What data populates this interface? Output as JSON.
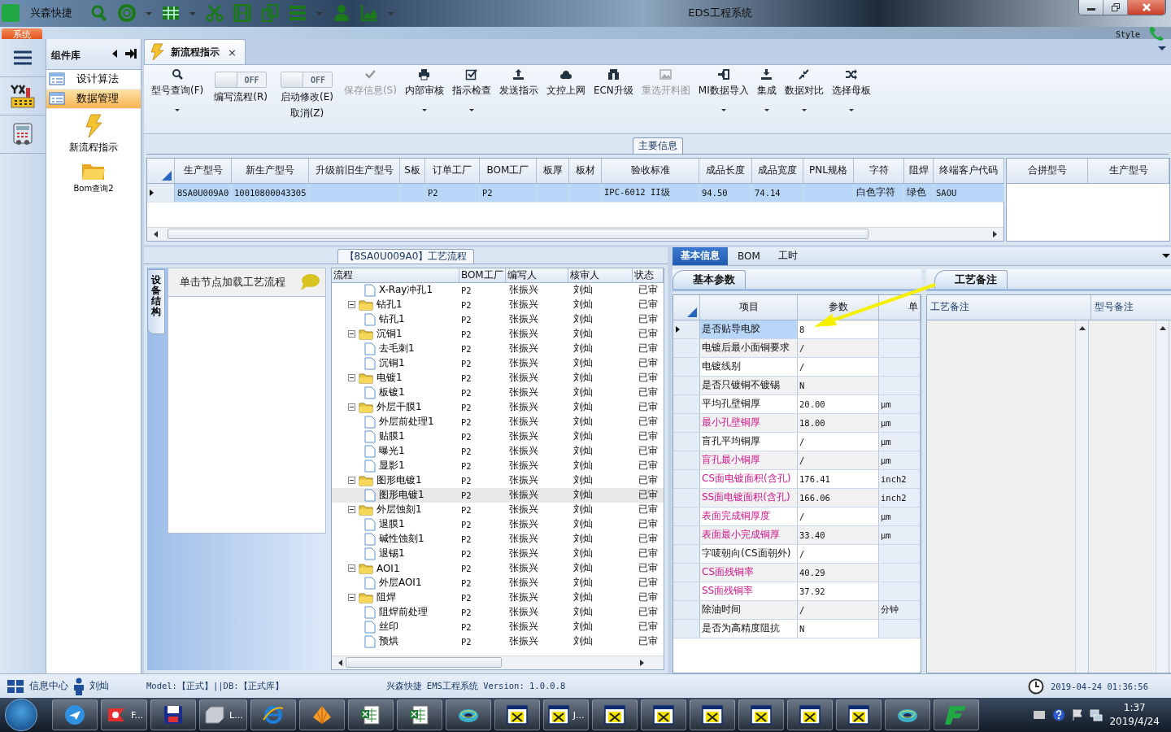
{
  "window": {
    "app_name": "兴森快捷",
    "title": "EDS工程系统",
    "menu_tab": "系统",
    "style_label": "Style"
  },
  "component_library": {
    "title": "组件库",
    "items": [
      {
        "label": "设计算法",
        "selected": false
      },
      {
        "label": "数据管理",
        "selected": true
      }
    ],
    "tools": [
      {
        "kind": "lightning",
        "label": "新流程指示"
      },
      {
        "kind": "folder",
        "label": "Bom查询2"
      }
    ]
  },
  "doc_tab": {
    "title": "新流程指示",
    "close": "×"
  },
  "ribbon": {
    "buttons": [
      {
        "kind": "button",
        "label": "型号查询(F)",
        "disabled": false,
        "dropdown": true
      },
      {
        "kind": "toggle",
        "label": "编写流程(R)",
        "toggle": "OFF",
        "on": false
      },
      {
        "kind": "toggle",
        "label": "启动修改(E)",
        "sublabel": "取消(Z)",
        "toggle": "OFF",
        "on": false
      },
      {
        "kind": "button",
        "label": "保存信息(S)",
        "disabled": true,
        "dropdown": false
      },
      {
        "kind": "button",
        "label": "内部审核",
        "disabled": false,
        "dropdown": true
      },
      {
        "kind": "button",
        "label": "指示检查",
        "disabled": false,
        "dropdown": true
      },
      {
        "kind": "button",
        "label": "发送指示",
        "disabled": false,
        "dropdown": false
      },
      {
        "kind": "button",
        "label": "文控上网",
        "disabled": false,
        "dropdown": false
      },
      {
        "kind": "button",
        "label": "ECN升级",
        "disabled": false,
        "dropdown": false
      },
      {
        "kind": "button",
        "label": "重选开料图",
        "disabled": true,
        "dropdown": false
      },
      {
        "kind": "button",
        "label": "MI数据导入",
        "disabled": false,
        "dropdown": true
      },
      {
        "kind": "button",
        "label": "集成",
        "disabled": false,
        "dropdown": true
      },
      {
        "kind": "button",
        "label": "数据对比",
        "disabled": false,
        "dropdown": true
      },
      {
        "kind": "button",
        "label": "选择母板",
        "disabled": false,
        "dropdown": true
      }
    ]
  },
  "main_info": {
    "title": "主要信息",
    "columns": [
      "生产型号",
      "新生产型号",
      "升级前旧生产型号",
      "S板",
      "订单工厂",
      "BOM工厂",
      "板厚",
      "板材",
      "验收标准",
      "成品长度",
      "成品宽度",
      "PNL规格",
      "字符",
      "阻焊",
      "终端客户代码"
    ],
    "rows": [
      {
        "selected": true,
        "cells": [
          "8SA0U009A0",
          "10010800043305",
          null,
          null,
          "P2",
          "P2",
          null,
          null,
          "IPC-6012 II级",
          "94.50",
          "74.14",
          null,
          "白色字符",
          "绿色",
          "SAOU"
        ]
      }
    ],
    "merge_columns": [
      "合拼型号",
      "生产型号"
    ]
  },
  "process_flow": {
    "title": "【8SA0U009A0】工艺流程",
    "side_tab": "设备结构",
    "hint": "单击节点加载工艺流程",
    "columns": [
      "流程",
      "BOM工厂",
      "编写人",
      "核审人",
      "状态"
    ],
    "rows": [
      {
        "label": "X-Ray冲孔1",
        "bom": "P2",
        "writer": "张振兴",
        "reviewer": "刘灿",
        "status": "已审",
        "selected": false
      },
      {
        "label": "钻孔1",
        "bom": "P2",
        "writer": "张振兴",
        "reviewer": "刘灿",
        "status": "已审",
        "selected": false,
        "expanded": true,
        "children": [
          {
            "label": "钻孔1",
            "bom": "P2",
            "writer": "张振兴",
            "reviewer": "刘灿",
            "status": "已审",
            "selected": false
          }
        ]
      },
      {
        "label": "沉铜1",
        "bom": "P2",
        "writer": "张振兴",
        "reviewer": "刘灿",
        "status": "已审",
        "selected": false,
        "expanded": true,
        "children": [
          {
            "label": "去毛刺1",
            "bom": "P2",
            "writer": "张振兴",
            "reviewer": "刘灿",
            "status": "已审",
            "selected": false
          },
          {
            "label": "沉铜1",
            "bom": "P2",
            "writer": "张振兴",
            "reviewer": "刘灿",
            "status": "已审",
            "selected": false
          }
        ]
      },
      {
        "label": "电镀1",
        "bom": "P2",
        "writer": "张振兴",
        "reviewer": "刘灿",
        "status": "已审",
        "selected": false,
        "expanded": true,
        "children": [
          {
            "label": "板镀1",
            "bom": "P2",
            "writer": "张振兴",
            "reviewer": "刘灿",
            "status": "已审",
            "selected": false
          }
        ]
      },
      {
        "label": "外层干膜1",
        "bom": "P2",
        "writer": "张振兴",
        "reviewer": "刘灿",
        "status": "已审",
        "selected": false,
        "expanded": true,
        "children": [
          {
            "label": "外层前处理1",
            "bom": "P2",
            "writer": "张振兴",
            "reviewer": "刘灿",
            "status": "已审",
            "selected": false
          },
          {
            "label": "贴膜1",
            "bom": "P2",
            "writer": "张振兴",
            "reviewer": "刘灿",
            "status": "已审",
            "selected": false
          },
          {
            "label": "曝光1",
            "bom": "P2",
            "writer": "张振兴",
            "reviewer": "刘灿",
            "status": "已审",
            "selected": false
          },
          {
            "label": "显影1",
            "bom": "P2",
            "writer": "张振兴",
            "reviewer": "刘灿",
            "status": "已审",
            "selected": false
          }
        ]
      },
      {
        "label": "图形电镀1",
        "bom": "P2",
        "writer": "张振兴",
        "reviewer": "刘灿",
        "status": "已审",
        "selected": false,
        "expanded": true,
        "children": [
          {
            "label": "图形电镀1",
            "bom": "P2",
            "writer": "张振兴",
            "reviewer": "刘灿",
            "status": "已审",
            "selected": true
          }
        ]
      },
      {
        "label": "外层蚀刻1",
        "bom": "P2",
        "writer": "张振兴",
        "reviewer": "刘灿",
        "status": "已审",
        "selected": false,
        "expanded": true,
        "children": [
          {
            "label": "退膜1",
            "bom": "P2",
            "writer": "张振兴",
            "reviewer": "刘灿",
            "status": "已审",
            "selected": false
          },
          {
            "label": "碱性蚀刻1",
            "bom": "P2",
            "writer": "张振兴",
            "reviewer": "刘灿",
            "status": "已审",
            "selected": false
          },
          {
            "label": "退锡1",
            "bom": "P2",
            "writer": "张振兴",
            "reviewer": "刘灿",
            "status": "已审",
            "selected": false
          }
        ]
      },
      {
        "label": "AOI1",
        "bom": "P2",
        "writer": "张振兴",
        "reviewer": "刘灿",
        "status": "已审",
        "selected": false,
        "expanded": true,
        "children": [
          {
            "label": "外层AOI1",
            "bom": "P2",
            "writer": "张振兴",
            "reviewer": "刘灿",
            "status": "已审",
            "selected": false
          }
        ]
      },
      {
        "label": "阻焊",
        "bom": "P2",
        "writer": "张振兴",
        "reviewer": "刘灿",
        "status": "已审",
        "selected": false,
        "expanded": true,
        "children": [
          {
            "label": "阻焊前处理",
            "bom": "P2",
            "writer": "张振兴",
            "reviewer": "刘灿",
            "status": "已审",
            "selected": false
          },
          {
            "label": "丝印",
            "bom": "P2",
            "writer": "张振兴",
            "reviewer": "刘灿",
            "status": "已审",
            "selected": false
          },
          {
            "label": "预烘",
            "bom": "P2",
            "writer": "张振兴",
            "reviewer": "刘灿",
            "status": "已审",
            "selected": false
          }
        ]
      }
    ]
  },
  "details": {
    "tabs": [
      {
        "label": "基本信息",
        "selected": true
      },
      {
        "label": "BOM",
        "selected": false
      },
      {
        "label": "工时",
        "selected": false
      }
    ],
    "params": {
      "tab": "基本参数",
      "columns": [
        "项目",
        "参数",
        "单"
      ],
      "rows": [
        {
          "item": "是否贴导电胶",
          "value": "8",
          "highlighted": false,
          "selected": true
        },
        {
          "item": "电镀后最小面铜要求",
          "value": "/",
          "highlighted": false,
          "selected": false
        },
        {
          "item": "电镀线别",
          "value": "/",
          "highlighted": false,
          "selected": false
        },
        {
          "item": "是否只镀铜不镀锡",
          "value": "N",
          "highlighted": false,
          "selected": false
        },
        {
          "item": "平均孔壁铜厚",
          "value": "20.00",
          "unit": "μm",
          "highlighted": false,
          "selected": false
        },
        {
          "item": "最小孔壁铜厚",
          "value": "18.00",
          "unit": "μm",
          "highlighted": true,
          "selected": false
        },
        {
          "item": "盲孔平均铜厚",
          "value": "/",
          "unit": "μm",
          "highlighted": false,
          "selected": false
        },
        {
          "item": "盲孔最小铜厚",
          "value": "/",
          "unit": "μm",
          "highlighted": true,
          "selected": false
        },
        {
          "item": "CS面电镀面积(含孔)",
          "value": "176.41",
          "unit": "inch2",
          "highlighted": true,
          "selected": false
        },
        {
          "item": "SS面电镀面积(含孔)",
          "value": "166.06",
          "unit": "inch2",
          "highlighted": true,
          "selected": false
        },
        {
          "item": "表面完成铜厚度",
          "value": "/",
          "unit": "μm",
          "highlighted": true,
          "selected": false
        },
        {
          "item": "表面最小完成铜厚",
          "value": "33.40",
          "unit": "μm",
          "highlighted": true,
          "selected": false
        },
        {
          "item": "字唛朝向(CS面朝外)",
          "value": "/",
          "highlighted": false,
          "selected": false
        },
        {
          "item": "CS面残铜率",
          "value": "40.29",
          "highlighted": true,
          "selected": false
        },
        {
          "item": "SS面残铜率",
          "value": "37.92",
          "highlighted": true,
          "selected": false
        },
        {
          "item": "除油时间",
          "value": "/",
          "unit": "分钟",
          "highlighted": false,
          "selected": false
        },
        {
          "item": "是否为高精度阻抗",
          "value": "N",
          "highlighted": false,
          "selected": false
        }
      ]
    },
    "notes": {
      "tab": "工艺备注",
      "columns": [
        "工艺备注",
        "型号备注"
      ]
    }
  },
  "status_bar": {
    "info": "信息中心",
    "user": "刘灿",
    "model": "Model:【正式】||DB:【正式库】",
    "product": "兴森快捷 EMS工程系统 Version: 1.0.0.8",
    "datetime": "2019-04-24 01:36:56"
  },
  "taskbar": {
    "buttons": [
      {
        "kind": "bird"
      },
      {
        "kind": "red",
        "label": "F..."
      },
      {
        "kind": "disk"
      },
      {
        "kind": "scanner",
        "label": "L..."
      },
      {
        "kind": "browser"
      },
      {
        "kind": "shell"
      },
      {
        "kind": "sheet"
      },
      {
        "kind": "sheet"
      },
      {
        "kind": "disc"
      },
      {
        "kind": "window"
      },
      {
        "kind": "window",
        "label": "J..."
      },
      {
        "kind": "window"
      },
      {
        "kind": "window"
      },
      {
        "kind": "window"
      },
      {
        "kind": "window"
      },
      {
        "kind": "window"
      },
      {
        "kind": "window"
      },
      {
        "kind": "disc"
      },
      {
        "kind": "logo"
      }
    ],
    "time": "1:37",
    "date": "2019/4/24"
  }
}
